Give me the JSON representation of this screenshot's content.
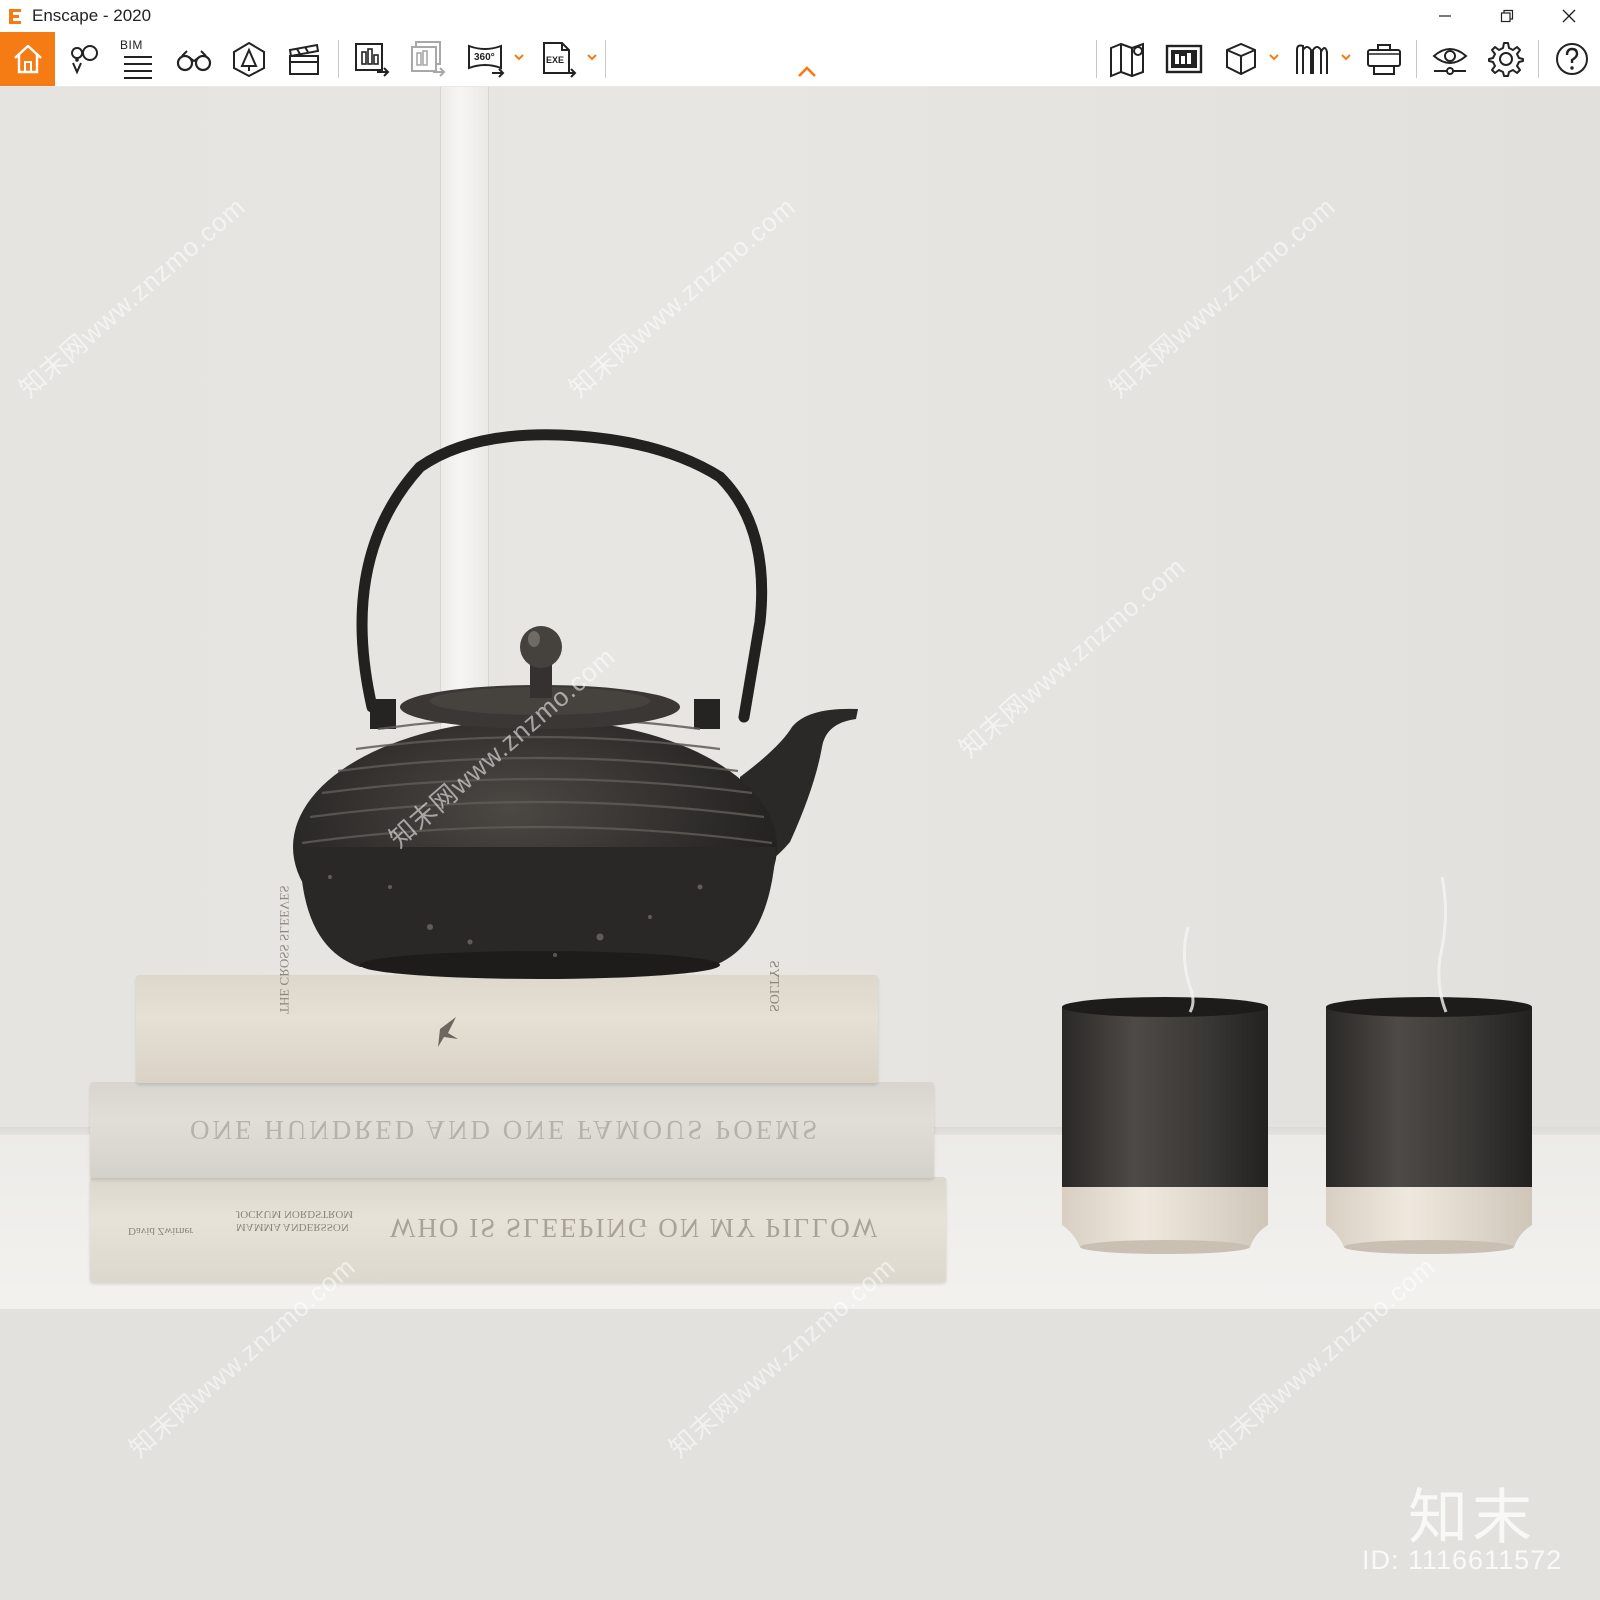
{
  "window": {
    "title": "Enscape - 2020",
    "controls": [
      "minimize",
      "restore",
      "close"
    ]
  },
  "toolbar": {
    "accent_color": "#f57c14",
    "left_buttons": [
      {
        "name": "home",
        "icon": "home-icon"
      },
      {
        "name": "views",
        "icon": "map-pin-icon"
      },
      {
        "name": "bim",
        "icon": "bim-list-icon",
        "label": "BIM"
      },
      {
        "name": "walk",
        "icon": "binoculars-icon"
      },
      {
        "name": "atlas",
        "icon": "asset-library-icon"
      },
      {
        "name": "video",
        "icon": "clapperboard-icon"
      },
      {
        "name": "screenshot",
        "icon": "image-export-icon"
      },
      {
        "name": "batch",
        "icon": "batch-export-icon"
      },
      {
        "name": "panorama",
        "icon": "panorama-360-icon",
        "label": "360°"
      },
      {
        "name": "export",
        "icon": "exe-export-icon",
        "label": "EXE"
      }
    ],
    "right_buttons": [
      {
        "name": "map",
        "icon": "map-icon"
      },
      {
        "name": "gallery",
        "icon": "gallery-icon"
      },
      {
        "name": "cube",
        "icon": "cube-icon"
      },
      {
        "name": "sync",
        "icon": "sync-views-icon"
      },
      {
        "name": "vr",
        "icon": "vr-headset-icon"
      },
      {
        "name": "visual",
        "icon": "eye-settings-icon"
      },
      {
        "name": "settings",
        "icon": "gear-icon"
      },
      {
        "name": "help",
        "icon": "help-icon"
      }
    ]
  },
  "scene": {
    "books": [
      {
        "title": "WHO IS SLEEPING ON MY PILLOW",
        "subtitle": "MAMMA ANDERSSON\nJOCKUM NORDSTROM",
        "author": "David Zwirner"
      },
      {
        "title": "ONE HUNDRED AND ONE FAMOUS POEMS"
      },
      {
        "title": "THE\nCROSS\nSLEEVES",
        "publisher": "SOLTYS"
      }
    ]
  },
  "watermark": {
    "text": "知末网www.znzmo.com",
    "brand": "知末",
    "id": "ID: 1116611572"
  }
}
